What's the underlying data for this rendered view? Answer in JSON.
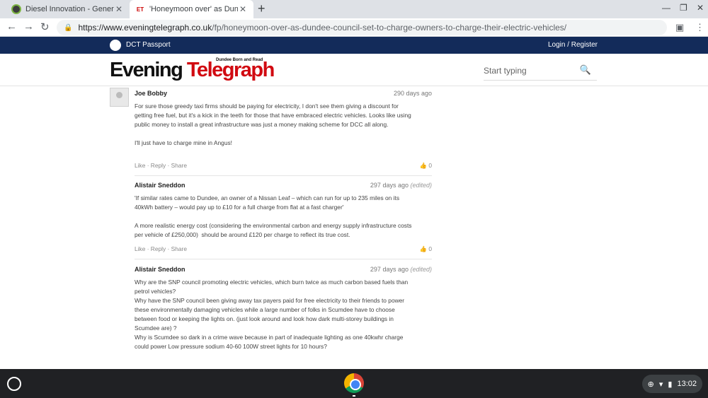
{
  "tabs": [
    {
      "title": "Diesel Innovation - General Autom",
      "active": false,
      "favicon": "green-circle"
    },
    {
      "title": "'Honeymoon over' as Dundee co",
      "active": true,
      "favicon": "ET"
    }
  ],
  "address_bar": {
    "host": "https://www.eveningtelegraph.co.uk",
    "path": "/fp/honeymoon-over-as-dundee-council-set-to-charge-owners-to-charge-their-electric-vehicles/"
  },
  "site": {
    "dct_label": "DCT Passport",
    "login": "Login / Register",
    "logo_word1": "Evening",
    "logo_word2": "Telegraph",
    "logo_tagline": "Dundee Born and Read",
    "search_placeholder": "Start typing"
  },
  "comments": [
    {
      "author": "Joe Bobby",
      "time": "290 days ago",
      "edited": "",
      "body": "For sure those greedy taxi firms should be paying for electricity, I don't see them giving a discount for\ngetting free fuel, but it's a kick in the teeth for those that have embraced electric vehicles. Looks like using\npublic money to install a great infrastructure was just a money making scheme for DCC all along.\n\nI'll just have to charge mine in Angus!",
      "actions": "Like · Reply · Share",
      "likes": "0"
    },
    {
      "author": "Alistair Sneddon",
      "time": "297 days ago",
      "edited": "(edited)",
      "body": "'If similar rates came to Dundee, an owner of a Nissan Leaf – which can run for up to 235 miles on its\n40kWh battery – would pay up to £10 for a full charge from flat at a fast charger'\n\nA more realistic energy cost (considering the environmental carbon and energy supply infrastructure costs\nper vehicle of £250,000)  should be around £120 per charge to reflect its true cost.",
      "actions": "Like · Reply · Share",
      "likes": "0"
    },
    {
      "author": "Alistair Sneddon",
      "time": "297 days ago",
      "edited": "(edited)",
      "body": "Why are the SNP council promoting electric vehicles, which burn twice as much carbon based fuels than\npetrol vehicles?\nWhy have the SNP council been giving away tax payers paid for free electricity to their friends to power\nthese environmentally damaging vehicles while a large number of folks in Scumdee have to choose\nbetween food or keeping the lights on. (just look around and look how dark multi-storey buildings in\nScumdee are) ?\nWhy is Scumdee so dark in a crime wave because in part of inadequate lighting as one 40kwhr charge\ncould power Low pressure sodium 40-60 100W street lights for 10 hours?",
      "actions": "",
      "likes": ""
    }
  ],
  "tray": {
    "time": "13:02"
  }
}
